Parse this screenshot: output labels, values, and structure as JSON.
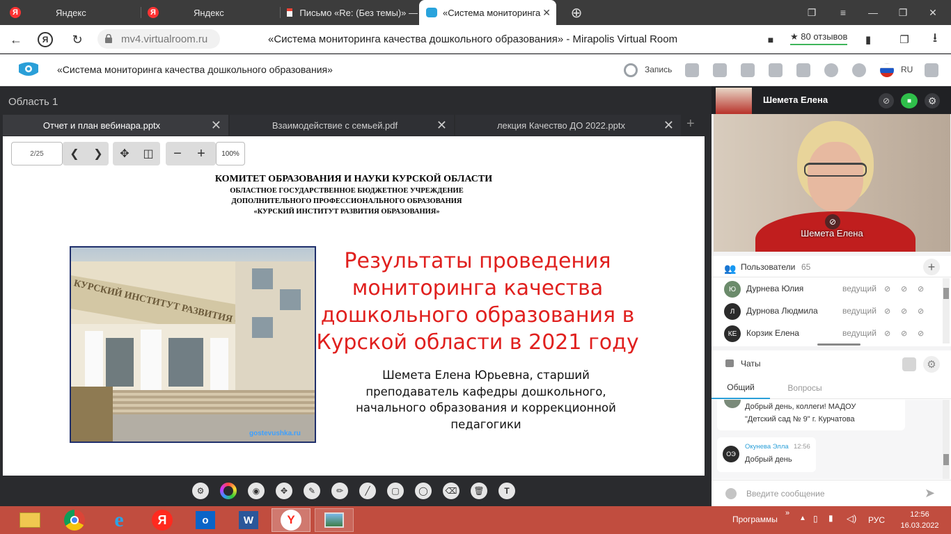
{
  "browser": {
    "tabs": [
      {
        "label": "Яндекс",
        "favicon": "Я"
      },
      {
        "label": "Яндекс",
        "favicon": "Я"
      },
      {
        "label": "Письмо «Re: (Без темы)» —",
        "favicon": "mail-icon"
      },
      {
        "label": "«Система мониторинга",
        "favicon": "mirapolis-icon"
      }
    ],
    "url": "mv4.virtualroom.ru",
    "page_title": "«Система мониторинга качества дошкольного образования» - Mirapolis Virtual Room",
    "reviews": "★ 80 отзывов"
  },
  "app": {
    "title": "«Система мониторинга качества дошкольного образования»",
    "record_label": "Запись",
    "language": "RU"
  },
  "area": {
    "title": "Область 1",
    "doc_tabs": [
      {
        "label": "Отчет и план вебинара.pptx"
      },
      {
        "label": "Взаимодействие с семьей.pdf"
      },
      {
        "label": "лекция Качество ДО 2022.pptx"
      }
    ],
    "page_indicator": "2/25",
    "zoom": "100%"
  },
  "slide": {
    "header1": "КОМИТЕТ ОБРАЗОВАНИЯ И НАУКИ КУРСКОЙ ОБЛАСТИ",
    "header2": "ОБЛАСТНОЕ ГОСУДАРСТВЕННОЕ БЮДЖЕТНОЕ УЧРЕЖДЕНИЕ",
    "header3": "ДОПОЛНИТЕЛЬНОГО ПРОФЕССИОНАЛЬНОГО ОБРАЗОВАНИЯ",
    "header4": "«КУРСКИЙ ИНСТИТУТ РАЗВИТИЯ ОБРАЗОВАНИЯ»",
    "title_lines": [
      "Результаты проведения",
      "мониторинга качества",
      "дошкольного образования  в",
      "Курской области в 2021 году"
    ],
    "author_lines": [
      "Шемета Елена Юрьевна, старший",
      "преподаватель кафедры дошкольного,",
      "начального образования и коррекционной",
      "педагогики"
    ],
    "photo_sign": "КУРСКИЙ ИНСТИТУТ РАЗВИТИЯ ОБРАЗОВАНИЯ",
    "photo_watermark": "gostevushka.ru",
    "title_color": "#e0201e"
  },
  "presenter": {
    "name": "Шемета Елена",
    "video_label": "Шемета Елена"
  },
  "users": {
    "title": "Пользователи",
    "count": "65",
    "list": [
      {
        "initials": "Ю",
        "name": "Дурнева Юлия",
        "role": "ведущий",
        "avatar_color": "#6b8b6b"
      },
      {
        "initials": "Л",
        "name": "Дурнова Людмила",
        "role": "ведущий",
        "avatar_color": "#2b2b2b"
      },
      {
        "initials": "КЕ",
        "name": "Корзик Елена",
        "role": "ведущий",
        "avatar_color": "#2b2b2b"
      }
    ]
  },
  "chats": {
    "title": "Чаты",
    "tabs": [
      "Общий",
      "Вопросы"
    ],
    "messages": [
      {
        "text1": "Добрый день, коллеги! МАДОУ",
        "text2": "\"Детский сад № 9\" г. Курчатова"
      },
      {
        "initials": "ОЭ",
        "author": "Окунева Элла",
        "time": "12:56",
        "text": "Добрый день"
      }
    ],
    "input_placeholder": "Введите сообщение"
  },
  "taskbar": {
    "programs": "Программы",
    "lang": "РУС",
    "time": "12:56",
    "date": "16.03.2022"
  }
}
